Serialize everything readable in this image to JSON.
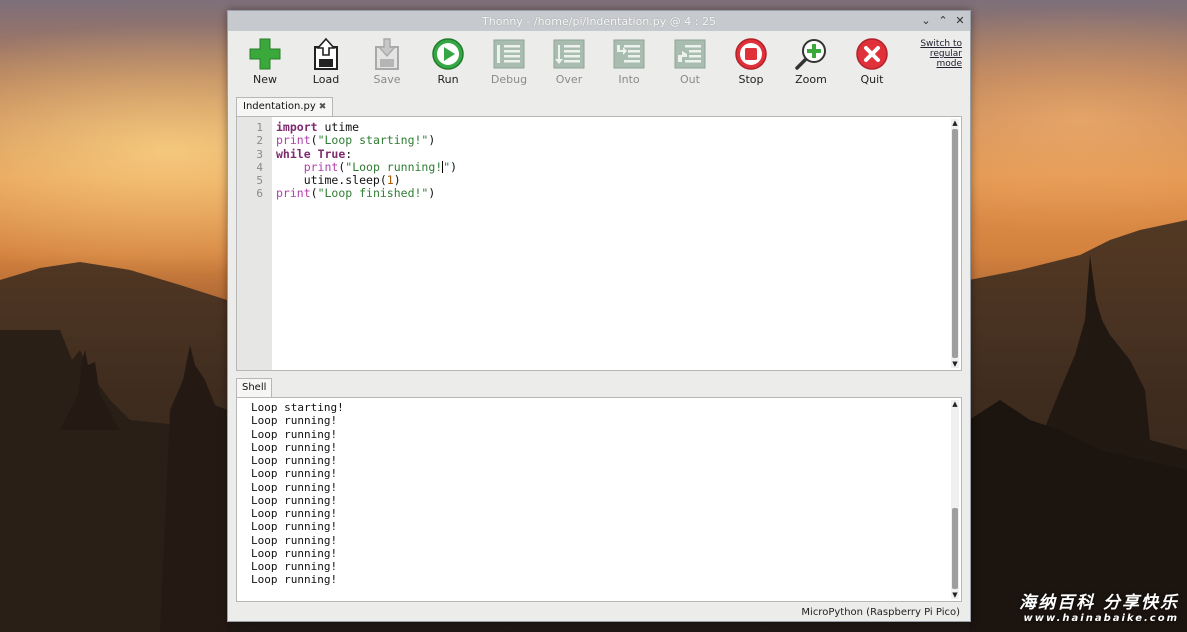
{
  "window": {
    "title": "Thonny  -  /home/pi/Indentation.py  @  4 : 25"
  },
  "window_controls": [
    "⌄",
    "⌃",
    "✕"
  ],
  "toolbar": {
    "buttons": [
      {
        "label": "New",
        "icon": "new-file-plus-icon",
        "enabled": true,
        "color": "#3aa83a"
      },
      {
        "label": "Load",
        "icon": "load-file-icon",
        "enabled": true,
        "color": "#333333"
      },
      {
        "label": "Save",
        "icon": "save-file-icon",
        "enabled": false,
        "color": "#a9a9a9"
      },
      {
        "label": "Run",
        "icon": "run-play-icon",
        "enabled": true,
        "color": "#35a845"
      },
      {
        "label": "Debug",
        "icon": "debug-icon",
        "enabled": false,
        "color": "#9fb3a6"
      },
      {
        "label": "Over",
        "icon": "step-over-icon",
        "enabled": false,
        "color": "#9fb3a6"
      },
      {
        "label": "Into",
        "icon": "step-into-icon",
        "enabled": false,
        "color": "#9fb3a6"
      },
      {
        "label": "Out",
        "icon": "step-out-icon",
        "enabled": false,
        "color": "#9fb3a6"
      },
      {
        "label": "Stop",
        "icon": "stop-icon",
        "enabled": true,
        "color": "#e0303a"
      },
      {
        "label": "Zoom",
        "icon": "zoom-magnifier-icon",
        "enabled": true,
        "color": "#3aa83a"
      },
      {
        "label": "Quit",
        "icon": "quit-x-icon",
        "enabled": true,
        "color": "#e0303a"
      }
    ],
    "switch_mode_label": "Switch to regular mode"
  },
  "editor": {
    "tab_label": "Indentation.py",
    "tab_close": "✖",
    "line_numbers": [
      "1",
      "2",
      "3",
      "4",
      "5",
      "6"
    ],
    "lines": [
      [
        {
          "t": "import",
          "c": "kw"
        },
        {
          "t": " utime",
          "c": ""
        }
      ],
      [
        {
          "t": "print",
          "c": "fn"
        },
        {
          "t": "(",
          "c": ""
        },
        {
          "t": "\"Loop starting!\"",
          "c": "str"
        },
        {
          "t": ")",
          "c": ""
        }
      ],
      [
        {
          "t": "while",
          "c": "kw"
        },
        {
          "t": " ",
          "c": ""
        },
        {
          "t": "True",
          "c": "kw"
        },
        {
          "t": ":",
          "c": ""
        }
      ],
      [
        {
          "t": "    ",
          "c": ""
        },
        {
          "t": "print",
          "c": "fn"
        },
        {
          "t": "(",
          "c": ""
        },
        {
          "t": "\"Loop running!",
          "c": "str"
        },
        {
          "t": "|",
          "c": "caret"
        },
        {
          "t": "\"",
          "c": "str"
        },
        {
          "t": ")",
          "c": ""
        }
      ],
      [
        {
          "t": "    utime.sleep(",
          "c": ""
        },
        {
          "t": "1",
          "c": "num"
        },
        {
          "t": ")",
          "c": ""
        }
      ],
      [
        {
          "t": "print",
          "c": "fn"
        },
        {
          "t": "(",
          "c": ""
        },
        {
          "t": "\"Loop finished!\"",
          "c": "str"
        },
        {
          "t": ")",
          "c": ""
        }
      ]
    ]
  },
  "shell": {
    "tab_label": "Shell",
    "output": [
      "Loop starting!",
      "Loop running!",
      "Loop running!",
      "Loop running!",
      "Loop running!",
      "Loop running!",
      "Loop running!",
      "Loop running!",
      "Loop running!",
      "Loop running!",
      "Loop running!",
      "Loop running!",
      "Loop running!",
      "Loop running!"
    ]
  },
  "statusbar": {
    "interpreter": "MicroPython (Raspberry Pi Pico)"
  },
  "watermark": {
    "title": "海纳百科 分享快乐",
    "url": "www.hainabaike.com"
  }
}
